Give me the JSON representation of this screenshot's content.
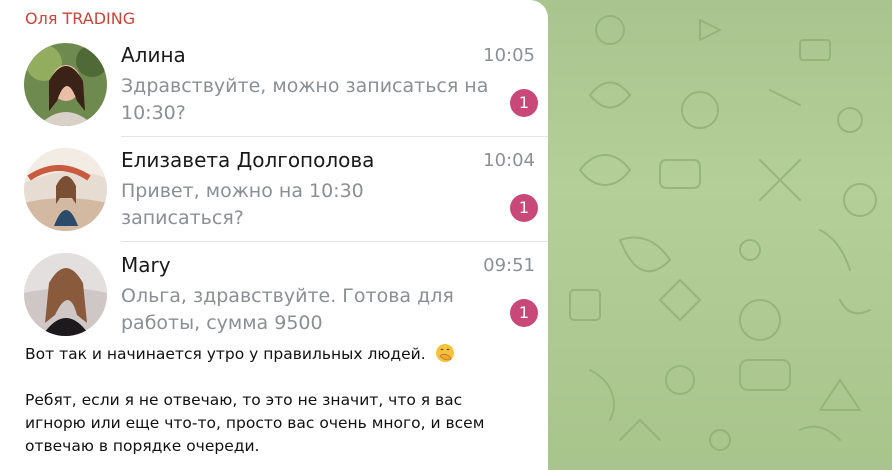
{
  "sender": "Оля TRADING",
  "chats": [
    {
      "name": "Алина",
      "time": "10:05",
      "preview": "Здравствуйте, можно записаться на 10:30?",
      "unread": "1"
    },
    {
      "name": "Елизавета Долгополова",
      "time": "10:04",
      "preview": "Привет, можно на 10:30 записаться?",
      "unread": "1"
    },
    {
      "name": "Mary",
      "time": "09:51",
      "preview": "Ольга, здравствуйте. Готова для работы, сумма 9500",
      "unread": "1"
    }
  ],
  "message": {
    "line1": "Вот так и начинается утро у правильных людей.",
    "line1_emoji": "face-with-hand-over-mouth-icon",
    "line2": "Ребят, если я не отвечаю, то это не значит, что я вас игнорю или еще что-то, просто вас очень много, и всем отвечаю в порядке очереди."
  },
  "colors": {
    "sender": "#c7463a",
    "badge": "#c9487a",
    "wallpaper": "#aac68e"
  }
}
